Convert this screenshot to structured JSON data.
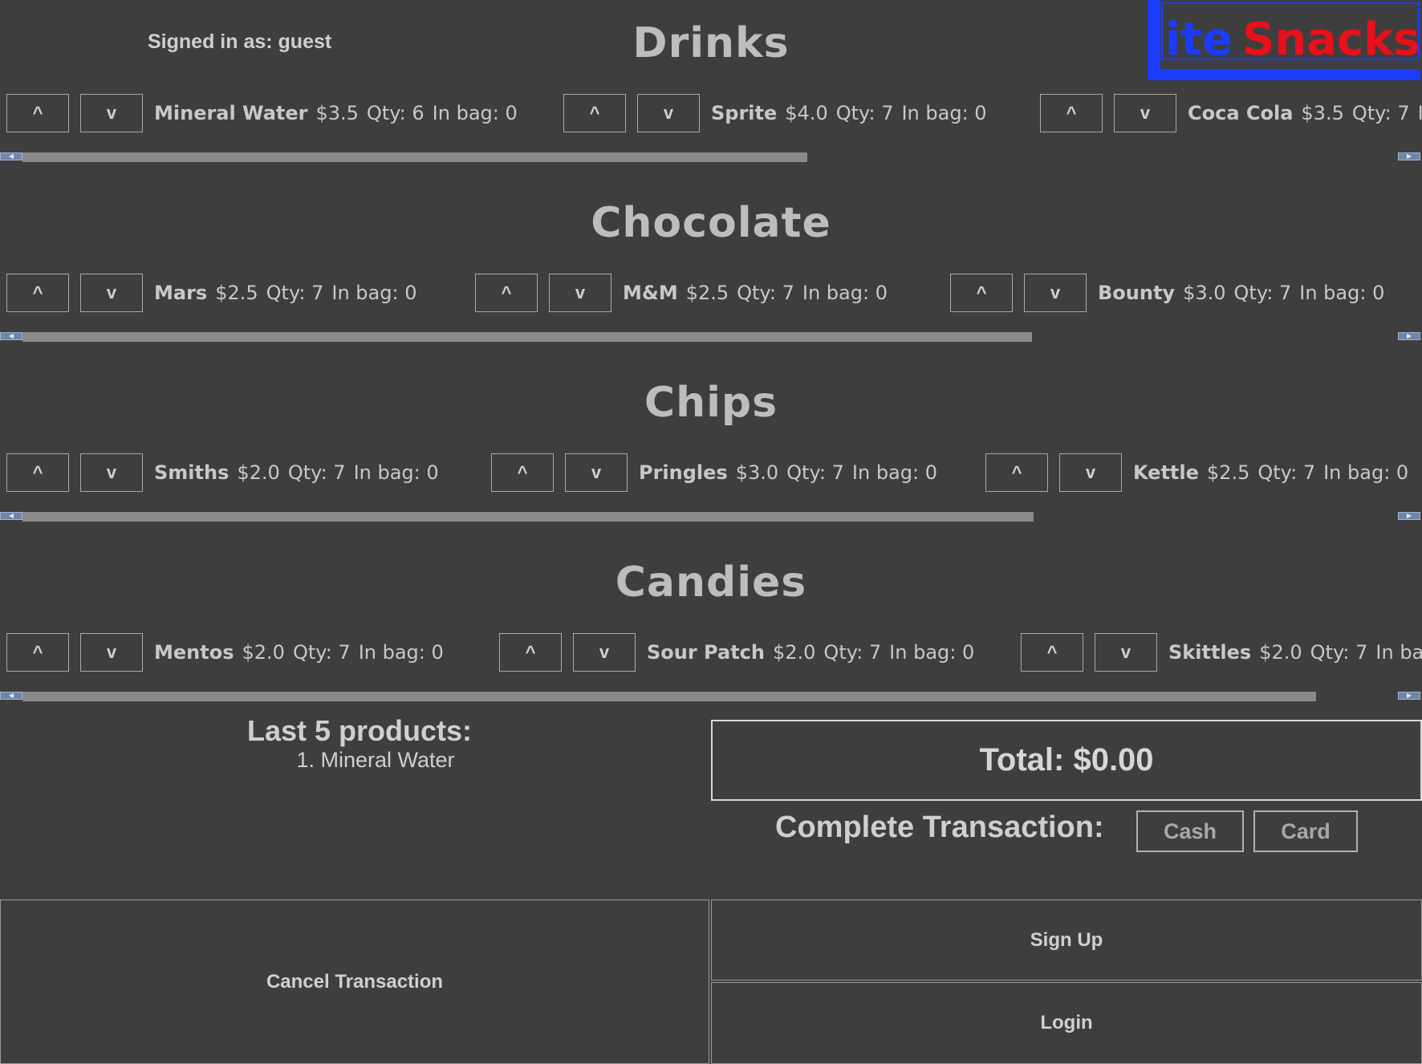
{
  "header": {
    "signed_in": "Signed in as: guest",
    "logo": {
      "text_first": "ite",
      "text_second": "Snacks",
      "color_blue": "#1a3cff",
      "color_red": "#e8101a"
    }
  },
  "categories": [
    {
      "title": "Drinks",
      "items": [
        {
          "up": "^",
          "down": "v",
          "name": "Mineral Water",
          "price": "$3.5",
          "qty": "Qty: 6",
          "bag": "In bag: 0"
        },
        {
          "up": "^",
          "down": "v",
          "name": "Sprite",
          "price": "$4.0",
          "qty": "Qty: 7",
          "bag": "In bag: 0"
        },
        {
          "up": "^",
          "down": "v",
          "name": "Coca Cola",
          "price": "$3.5",
          "qty": "Qty: 7",
          "bag": "In"
        }
      ]
    },
    {
      "title": "Chocolate",
      "items": [
        {
          "up": "^",
          "down": "v",
          "name": "Mars",
          "price": "$2.5",
          "qty": "Qty: 7",
          "bag": "In bag: 0"
        },
        {
          "up": "^",
          "down": "v",
          "name": "M&M",
          "price": "$2.5",
          "qty": "Qty: 7",
          "bag": "In bag: 0"
        },
        {
          "up": "^",
          "down": "v",
          "name": "Bounty",
          "price": "$3.0",
          "qty": "Qty: 7",
          "bag": "In bag: 0"
        }
      ]
    },
    {
      "title": "Chips",
      "items": [
        {
          "up": "^",
          "down": "v",
          "name": "Smiths",
          "price": "$2.0",
          "qty": "Qty: 7",
          "bag": "In bag: 0"
        },
        {
          "up": "^",
          "down": "v",
          "name": "Pringles",
          "price": "$3.0",
          "qty": "Qty: 7",
          "bag": "In bag: 0"
        },
        {
          "up": "^",
          "down": "v",
          "name": "Kettle",
          "price": "$2.5",
          "qty": "Qty: 7",
          "bag": "In bag: 0"
        }
      ]
    },
    {
      "title": "Candies",
      "items": [
        {
          "up": "^",
          "down": "v",
          "name": "Mentos",
          "price": "$2.0",
          "qty": "Qty: 7",
          "bag": "In bag: 0"
        },
        {
          "up": "^",
          "down": "v",
          "name": "Sour Patch",
          "price": "$2.0",
          "qty": "Qty: 7",
          "bag": "In bag: 0"
        },
        {
          "up": "^",
          "down": "v",
          "name": "Skittles",
          "price": "$2.0",
          "qty": "Qty: 7",
          "bag": "In bag:"
        }
      ]
    }
  ],
  "last_products": {
    "title": "Last 5 products:",
    "items": [
      "1. Mineral Water"
    ]
  },
  "total": "Total: $0.00",
  "complete": {
    "label": "Complete Transaction:",
    "cash": "Cash",
    "card": "Card"
  },
  "actions": {
    "cancel": "Cancel Transaction",
    "signup": "Sign Up",
    "login": "Login"
  }
}
